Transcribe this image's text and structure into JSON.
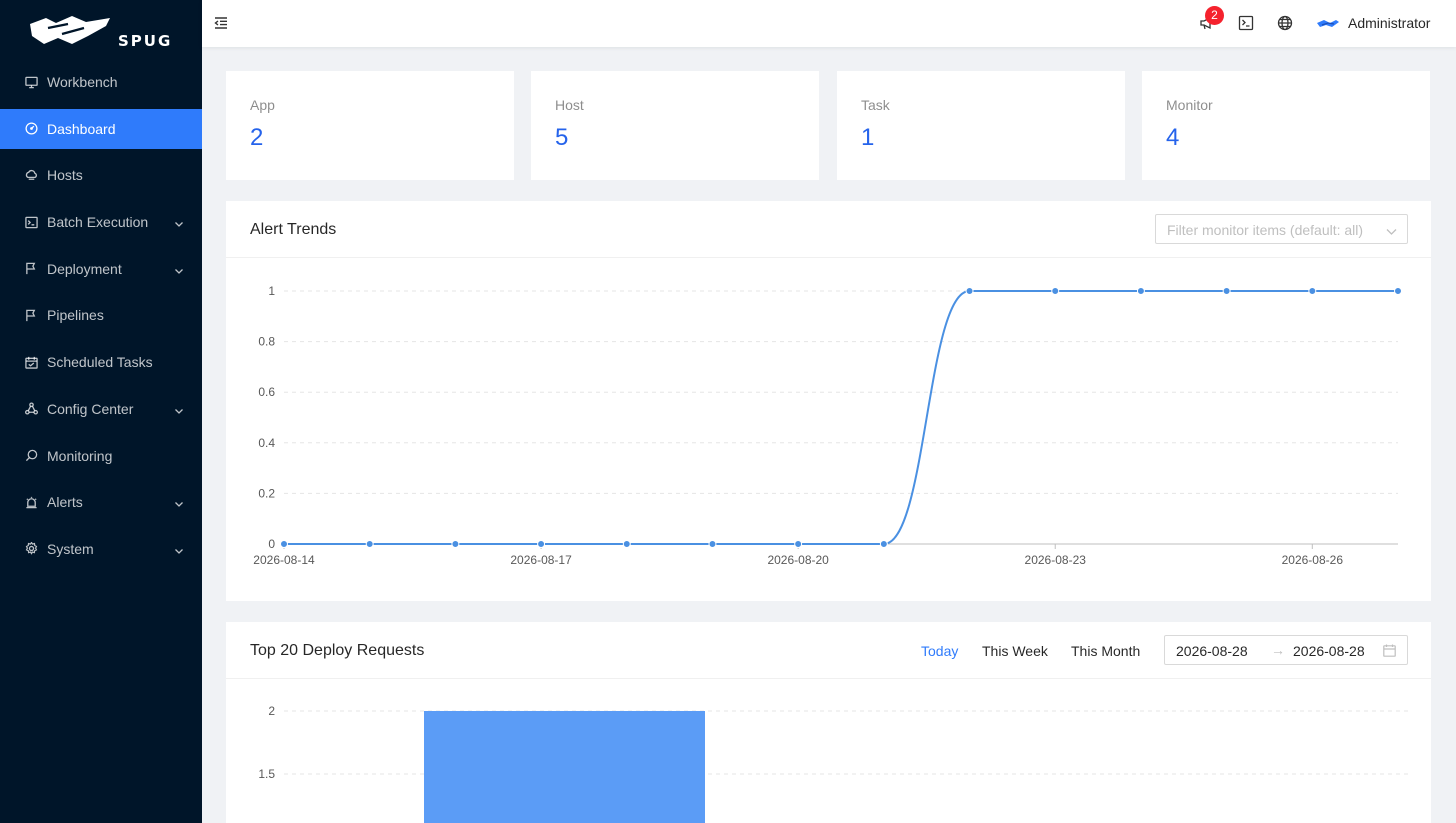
{
  "brand": {
    "logo_text": "SPUG"
  },
  "sidebar": {
    "items": [
      {
        "label": "Workbench",
        "icon": "desktop-icon",
        "expandable": false,
        "active": false
      },
      {
        "label": "Dashboard",
        "icon": "dashboard-icon",
        "expandable": false,
        "active": true
      },
      {
        "label": "Hosts",
        "icon": "cloud-server-icon",
        "expandable": false,
        "active": false
      },
      {
        "label": "Batch Execution",
        "icon": "code-icon",
        "expandable": true,
        "active": false
      },
      {
        "label": "Deployment",
        "icon": "flag-icon",
        "expandable": true,
        "active": false
      },
      {
        "label": "Pipelines",
        "icon": "flag-icon",
        "expandable": false,
        "active": false
      },
      {
        "label": "Scheduled Tasks",
        "icon": "schedule-icon",
        "expandable": false,
        "active": false
      },
      {
        "label": "Config Center",
        "icon": "deployment-unit-icon",
        "expandable": true,
        "active": false
      },
      {
        "label": "Monitoring",
        "icon": "monitor-icon",
        "expandable": false,
        "active": false
      },
      {
        "label": "Alerts",
        "icon": "alert-icon",
        "expandable": true,
        "active": false
      },
      {
        "label": "System",
        "icon": "setting-icon",
        "expandable": true,
        "active": false
      }
    ]
  },
  "header": {
    "notification_count": "2",
    "user_name": "Administrator"
  },
  "stats": [
    {
      "label": "App",
      "value": "2"
    },
    {
      "label": "Host",
      "value": "5"
    },
    {
      "label": "Task",
      "value": "1"
    },
    {
      "label": "Monitor",
      "value": "4"
    }
  ],
  "alert_panel": {
    "title": "Alert Trends",
    "filter_placeholder": "Filter monitor items (default: all)"
  },
  "deploy_panel": {
    "title": "Top 20 Deploy Requests",
    "tabs": [
      "Today",
      "This Week",
      "This Month"
    ],
    "active_tab": "Today",
    "date_start": "2026-08-28",
    "date_end": "2026-08-28"
  },
  "colors": {
    "primary": "#2f7bfb",
    "line": "#4a90e2",
    "bar": "#5b9cf6",
    "sidebar": "#001529"
  },
  "chart_data": [
    {
      "type": "line",
      "x": [
        "2026-08-14",
        "2026-08-15",
        "2026-08-16",
        "2026-08-17",
        "2026-08-18",
        "2026-08-19",
        "2026-08-20",
        "2026-08-21",
        "2026-08-22",
        "2026-08-23",
        "2026-08-24",
        "2026-08-25",
        "2026-08-26",
        "2026-08-27"
      ],
      "x_tick_labels": [
        "2026-08-14",
        "2026-08-17",
        "2026-08-20",
        "2026-08-23",
        "2026-08-26"
      ],
      "values": [
        0,
        0,
        0,
        0,
        0,
        0,
        0,
        0,
        1,
        1,
        1,
        1,
        1,
        1
      ],
      "y_ticks": [
        "0",
        "0.2",
        "0.4",
        "0.6",
        "0.8",
        "1"
      ],
      "ylim": [
        0,
        1
      ],
      "grid": true
    },
    {
      "type": "bar",
      "values": [
        2
      ],
      "y_ticks": [
        "1.5",
        "2"
      ],
      "ylim": [
        0,
        2
      ],
      "grid": true
    }
  ]
}
